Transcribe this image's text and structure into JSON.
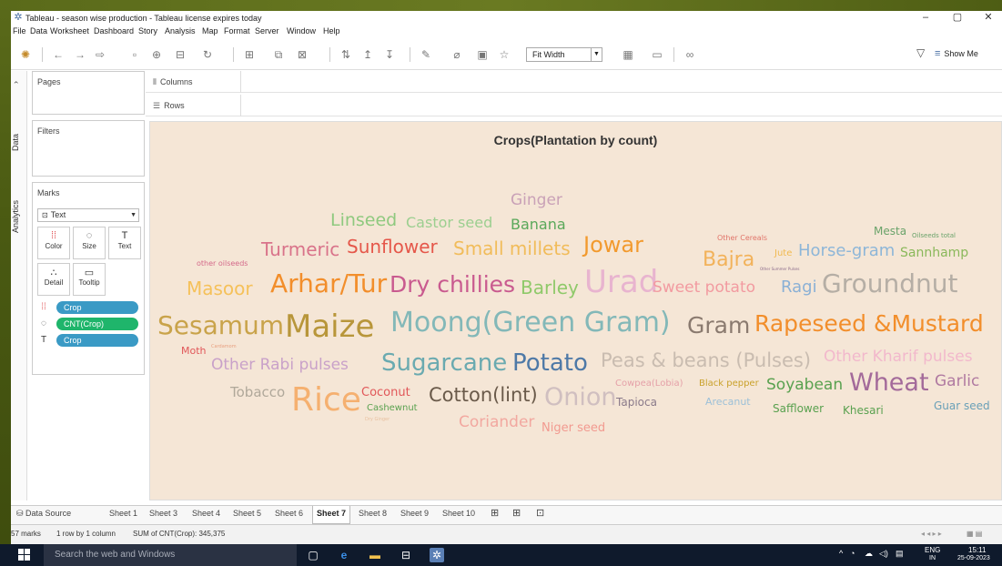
{
  "app": {
    "title": "Tableau - season wise production - Tableau license expires today",
    "window_controls": [
      "–",
      "▢",
      "✕"
    ]
  },
  "menu": [
    "File",
    "Data",
    "Worksheet",
    "Dashboard",
    "Story",
    "Analysis",
    "Map",
    "Format",
    "Server",
    "Window",
    "Help"
  ],
  "toolbar": {
    "fit": "Fit Width",
    "show_me": "Show Me"
  },
  "side_tabs": {
    "data": "Data",
    "analytics": "Analytics"
  },
  "cards": {
    "pages": "Pages",
    "filters": "Filters",
    "marks": "Marks",
    "mark_type": "Text",
    "buttons": [
      {
        "icon": "⁞⁞",
        "label": "Color"
      },
      {
        "icon": "◌",
        "label": "Size"
      },
      {
        "icon": "T",
        "label": "Text"
      },
      {
        "icon": "∴",
        "label": "Detail"
      },
      {
        "icon": "▭",
        "label": "Tooltip"
      }
    ],
    "pills": [
      {
        "label": "Crop",
        "color": "#3a9ac5",
        "icon": "⁞⁞"
      },
      {
        "label": "CNT(Crop)",
        "color": "#1fb56b",
        "icon": "◌"
      },
      {
        "label": "Crop",
        "color": "#3a9ac5",
        "icon": "T"
      }
    ]
  },
  "shelves": {
    "columns": "Columns",
    "rows": "Rows"
  },
  "viz": {
    "title": "Crops(Plantation by count)",
    "words": [
      {
        "text": "Ginger",
        "color": "#c9a1b7"
      },
      {
        "text": "Linseed",
        "color": "#8fc97f"
      },
      {
        "text": "Castor seed",
        "color": "#9ccf90"
      },
      {
        "text": "Banana",
        "color": "#5aa85a"
      },
      {
        "text": "Mesta",
        "color": "#6aa36a"
      },
      {
        "text": "Oilseeds total",
        "color": "#6aa36a"
      },
      {
        "text": "Other Cereals",
        "color": "#e1756a"
      },
      {
        "text": "Turmeric",
        "color": "#d9738a"
      },
      {
        "text": "Sunflower",
        "color": "#e5574a"
      },
      {
        "text": "Small millets",
        "color": "#f1bc5a"
      },
      {
        "text": "Jowar",
        "color": "#f29a2e"
      },
      {
        "text": "Jute",
        "color": "#f1b94e"
      },
      {
        "text": "Horse-gram",
        "color": "#8db6d8"
      },
      {
        "text": "Sannhamp",
        "color": "#8ab85a"
      },
      {
        "text": "other oilseeds",
        "color": "#d46a8a"
      },
      {
        "text": "Bajra",
        "color": "#f2b25a"
      },
      {
        "text": "Other Summer Pulses",
        "color": "#8a6a8a"
      },
      {
        "text": "Masoor",
        "color": "#f5c15a"
      },
      {
        "text": "Arhar/Tur",
        "color": "#f28e2b"
      },
      {
        "text": "Dry chillies",
        "color": "#c95a8f"
      },
      {
        "text": "Barley",
        "color": "#8fc96a"
      },
      {
        "text": "Urad",
        "color": "#e8b4cf"
      },
      {
        "text": "Sweet potato",
        "color": "#f29aa0"
      },
      {
        "text": "Ragi",
        "color": "#8ab0d5"
      },
      {
        "text": "Groundnut",
        "color": "#b5aea5"
      },
      {
        "text": "Sesamum",
        "color": "#c9a34a"
      },
      {
        "text": "Maize",
        "color": "#b8963a"
      },
      {
        "text": "Moong(Green Gram)",
        "color": "#83b8b8"
      },
      {
        "text": "Gram",
        "color": "#8a7a6f"
      },
      {
        "text": "Rapeseed &Mustard",
        "color": "#f28e2b"
      },
      {
        "text": "Moth",
        "color": "#e15759"
      },
      {
        "text": "Cardamom",
        "color": "#e8a080"
      },
      {
        "text": "Other Rabi pulses",
        "color": "#c9a1c9"
      },
      {
        "text": "Sugarcane",
        "color": "#6aaab0"
      },
      {
        "text": "Potato",
        "color": "#4e79a7"
      },
      {
        "text": "Peas & beans (Pulses)",
        "color": "#c9bcb0"
      },
      {
        "text": "Other Kharif pulses",
        "color": "#f2b8cc"
      },
      {
        "text": "Tobacco",
        "color": "#b0a89a"
      },
      {
        "text": "Rice",
        "color": "#f5b070"
      },
      {
        "text": "Coconut",
        "color": "#e15759"
      },
      {
        "text": "Cashewnut",
        "color": "#59a14f"
      },
      {
        "text": "Cotton(lint)",
        "color": "#6a5a4a"
      },
      {
        "text": "Onion",
        "color": "#d0bfc0"
      },
      {
        "text": "Tapioca",
        "color": "#8a7a8a"
      },
      {
        "text": "Cowpea(Lobia)",
        "color": "#e5a0a8"
      },
      {
        "text": "Black pepper",
        "color": "#c9a12a"
      },
      {
        "text": "Soyabean",
        "color": "#59a14f"
      },
      {
        "text": "Wheat",
        "color": "#a36a9a"
      },
      {
        "text": "Garlic",
        "color": "#b07aa1"
      },
      {
        "text": "Arecanut",
        "color": "#9cc0d8"
      },
      {
        "text": "Safflower",
        "color": "#59a14f"
      },
      {
        "text": "Khesari",
        "color": "#59a14f"
      },
      {
        "text": "Guar seed",
        "color": "#6aa0b8"
      },
      {
        "text": "Dry Ginger",
        "color": "#e8c0a0"
      },
      {
        "text": "Coriander",
        "color": "#f2a8a0"
      },
      {
        "text": "Niger seed",
        "color": "#f29a90"
      }
    ]
  },
  "sheets": {
    "data_source": "Data Source",
    "tabs": [
      "Sheet 1",
      "Sheet 3",
      "Sheet 4",
      "Sheet 5",
      "Sheet 6",
      "Sheet 7",
      "Sheet 8",
      "Sheet 9",
      "Sheet 10"
    ],
    "active": "Sheet 7"
  },
  "status": {
    "marks": "57 marks",
    "layout": "1 row by 1 column",
    "sum": "SUM of CNT(Crop): 345,375"
  },
  "taskbar": {
    "search_placeholder": "Search the web and Windows",
    "lang": "ENG",
    "region": "IN",
    "time": "15:11",
    "date": "25-09-2023"
  }
}
